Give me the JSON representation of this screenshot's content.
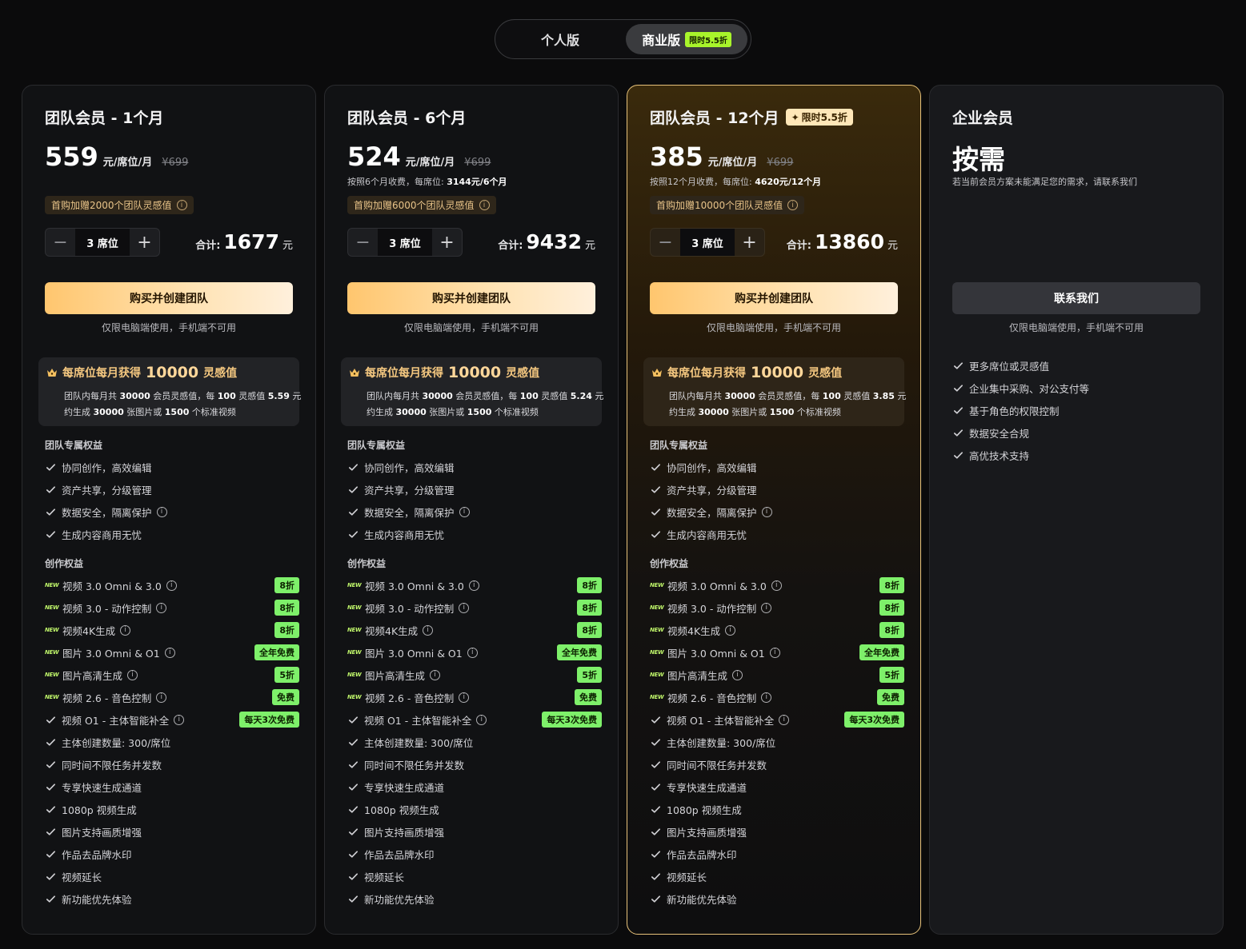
{
  "toggle": {
    "personal": "个人版",
    "business": "商业版",
    "business_tag": "限时5.5折"
  },
  "common": {
    "buy_label": "购买并创建团队",
    "pc_note": "仅限电脑端使用，手机端不可用",
    "unit": "元/席位/月",
    "total_label": "合计:",
    "currency": "元",
    "seat_value": "3 席位",
    "box_head_a": "每席位每月获得",
    "box_head_num": "10000",
    "box_head_b": "灵感值",
    "section_team": "团队专属权益",
    "section_create": "创作权益"
  },
  "plans": [
    {
      "title": "团队会员 - 1个月",
      "price": "559",
      "orig": "¥699",
      "note_a": "",
      "note_b": "",
      "gift": "首购加赠2000个团队灵感值",
      "total": "1677",
      "box_l1_a": "团队内每月共",
      "box_l1_b": "30000",
      "box_l1_c": "会员灵感值，每",
      "box_l1_d": "100",
      "box_l1_e": "灵感值",
      "box_l1_f": "5.59",
      "box_l1_g": "元",
      "box_l2_a": "约生成",
      "box_l2_b": "30000",
      "box_l2_c": "张图片或",
      "box_l2_d": "1500",
      "box_l2_e": "个标准视频"
    },
    {
      "title": "团队会员 - 6个月",
      "price": "524",
      "orig": "¥699",
      "note_a": "按照6个月收费，每席位: ",
      "note_b": "3144元/6个月",
      "gift": "首购加赠6000个团队灵感值",
      "total": "9432",
      "box_l1_a": "团队内每月共",
      "box_l1_b": "30000",
      "box_l1_c": "会员灵感值，每",
      "box_l1_d": "100",
      "box_l1_e": "灵感值",
      "box_l1_f": "5.24",
      "box_l1_g": "元",
      "box_l2_a": "约生成",
      "box_l2_b": "30000",
      "box_l2_c": "张图片或",
      "box_l2_d": "1500",
      "box_l2_e": "个标准视频"
    },
    {
      "title": "团队会员 - 12个月",
      "title_tag": "限时5.5折",
      "price": "385",
      "orig": "¥699",
      "note_a": "按照12个月收费，每席位: ",
      "note_b": "4620元/12个月",
      "gift": "首购加赠10000个团队灵感值",
      "total": "13860",
      "box_l1_a": "团队内每月共",
      "box_l1_b": "30000",
      "box_l1_c": "会员灵感值，每",
      "box_l1_d": "100",
      "box_l1_e": "灵感值",
      "box_l1_f": "3.85",
      "box_l1_g": "元",
      "box_l2_a": "约生成",
      "box_l2_b": "30000",
      "box_l2_c": "张图片或",
      "box_l2_d": "1500",
      "box_l2_e": "个标准视频"
    }
  ],
  "team_features": [
    "协同创作，高效编辑",
    "资产共享，分级管理",
    "数据安全，隔离保护",
    "生成内容商用无忧"
  ],
  "create_features": [
    {
      "label": "视频 3.0 Omni & 3.0",
      "new": "NEW",
      "badge": "8折"
    },
    {
      "label": "视频 3.0 - 动作控制",
      "new": "NEW",
      "badge": "8折"
    },
    {
      "label": "视频4K生成",
      "new": "NEW",
      "badge": "8折"
    },
    {
      "label": "图片 3.0 Omni & O1",
      "new": "NEW",
      "badge": "全年免费"
    },
    {
      "label": "图片高清生成",
      "new": "NEW",
      "badge": "5折"
    },
    {
      "label": "视频 2.6 - 音色控制",
      "new": "NEW",
      "badge": "免费"
    },
    {
      "label": "视频 O1 - 主体智能补全",
      "badge": "每天3次免费"
    },
    {
      "label": "主体创建数量: 300/席位"
    },
    {
      "label": "同时间不限任务并发数"
    },
    {
      "label": "专享快速生成通道"
    },
    {
      "label": "1080p 视频生成"
    },
    {
      "label": "图片支持画质增强"
    },
    {
      "label": "作品去品牌水印"
    },
    {
      "label": "视频延长"
    },
    {
      "label": "新功能优先体验"
    }
  ],
  "enterprise": {
    "title": "企业会员",
    "price": "按需",
    "note": "若当前会员方案未能满足您的需求，请联系我们",
    "button": "联系我们",
    "pc_note": "仅限电脑端使用，手机端不可用",
    "features": [
      "更多席位或灵感值",
      "企业集中采购、对公支付等",
      "基于角色的权限控制",
      "数据安全合规",
      "高优技术支持"
    ]
  },
  "colors": {
    "accent_gold": "#ffc66e",
    "badge_green": "#7ef06a",
    "tag_green": "#a8f52b",
    "highlight_border": "#e7c27a"
  }
}
